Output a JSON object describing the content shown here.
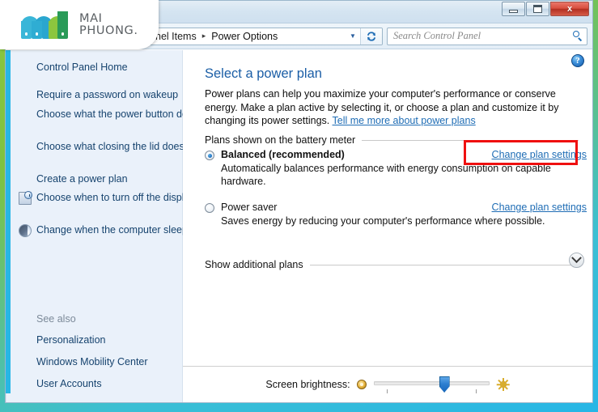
{
  "brand": {
    "name_line1": "MAI",
    "name_line2": "PHUONG.",
    "mark_colors": {
      "cyan": "#3ab6d8",
      "cyan_dark": "#2aa6cf",
      "green_light": "#8cc63e",
      "green_dark": "#2a9b58"
    }
  },
  "window": {
    "buttons": {
      "minimize": "Minimize",
      "maximize": "Maximize",
      "close": "x"
    }
  },
  "address_bar": {
    "breadcrumb": [
      {
        "label": "nel Items"
      },
      {
        "label": "Power Options"
      }
    ],
    "separator": "▸",
    "dropdown_caret": "▼",
    "refresh_label": "↻",
    "refresh_icon": "refresh-icon"
  },
  "search": {
    "placeholder": "Search Control Panel",
    "icon": "search-icon"
  },
  "sidebar": {
    "home_label": "Control Panel Home",
    "items": [
      {
        "label": "Require a password on wakeup",
        "icon": null
      },
      {
        "label": "Choose what the power button does",
        "icon": null
      },
      {
        "label": "Choose what closing the lid does",
        "icon": null
      },
      {
        "label": "Create a power plan",
        "icon": null
      },
      {
        "label": "Choose when to turn off the display",
        "icon": "display-clock-icon"
      },
      {
        "label": "Change when the computer sleeps",
        "icon": "sleep-moon-icon"
      }
    ],
    "see_also": {
      "heading": "See also",
      "items": [
        {
          "label": "Personalization"
        },
        {
          "label": "Windows Mobility Center"
        },
        {
          "label": "User Accounts"
        }
      ]
    }
  },
  "content": {
    "help_glyph": "?",
    "title": "Select a power plan",
    "intro_text": "Power plans can help you maximize your computer's performance or conserve energy. Make a plan active by selecting it, or choose a plan and customize it by changing its power settings. ",
    "intro_link": "Tell me more about power plans",
    "plans_group_label": "Plans shown on the battery meter",
    "plans": [
      {
        "name": "Balanced (recommended)",
        "selected": true,
        "description": "Automatically balances performance with energy consumption on capable hardware.",
        "action_label": "Change plan settings",
        "highlighted": true
      },
      {
        "name": "Power saver",
        "selected": false,
        "description": "Saves energy by reducing your computer's performance where possible.",
        "action_label": "Change plan settings",
        "highlighted": false
      }
    ],
    "additional_label": "Show additional plans",
    "additional_expand_icon": "chevron-down-icon",
    "highlight_color": "#ef1010"
  },
  "brightness": {
    "label": "Screen brightness:",
    "dim_icon": "dim-sun-icon",
    "bright_icon": "bright-sun-icon",
    "value_percent": 62
  }
}
